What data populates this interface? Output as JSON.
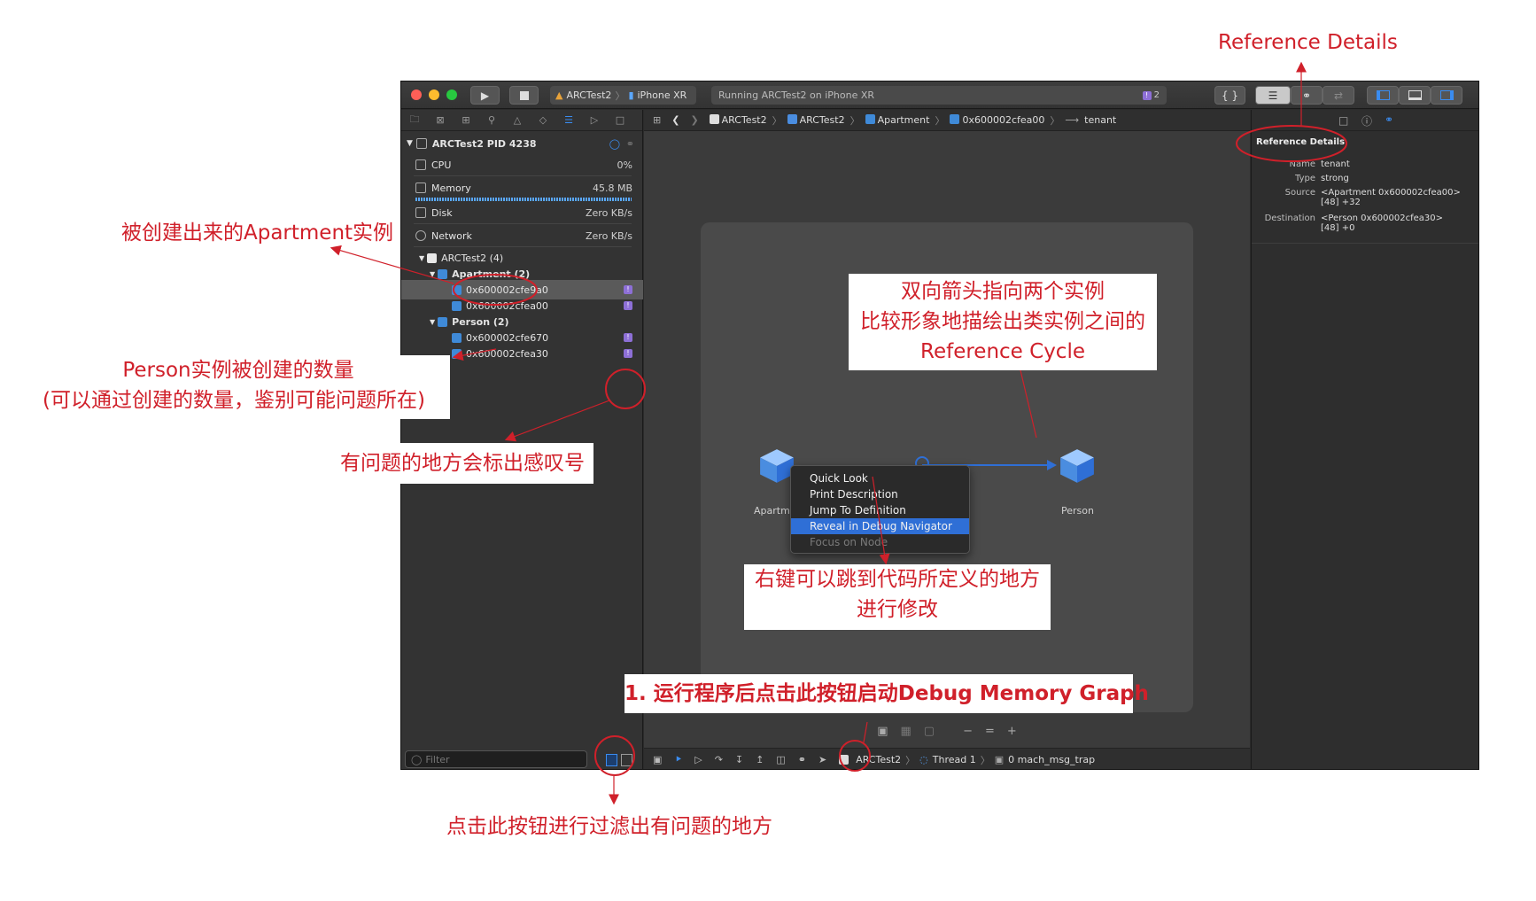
{
  "annotations": {
    "reference_details": "Reference Details",
    "apartment_instance": "被创建出来的Apartment实例",
    "person_count_line1": "Person实例被创建的数量",
    "person_count_line2": "(可以通过创建的数量，鉴别可能问题所在)",
    "exclamation_mark": "有问题的地方会标出感叹号",
    "arrow_line1": "双向箭头指向两个实例",
    "arrow_line2": "比较形象地描绘出类实例之间的",
    "arrow_line3": "Reference Cycle",
    "right_click_line1": "右键可以跳到代码所定义的地方",
    "right_click_line2": "进行修改",
    "start_graph": "1. 运行程序后点击此按钮启动Debug Memory Graph",
    "filter_button": "点击此按钮进行过滤出有问题的地方"
  },
  "toolbar": {
    "scheme_project": "ARCTest2",
    "scheme_device": "iPhone XR",
    "activity_text": "Running ARCTest2 on iPhone XR",
    "warning_count": "2",
    "warning_glyph": "!",
    "braces_label": "{ }"
  },
  "navigator": {
    "process": "ARCTest2 PID 4238",
    "gauges": [
      {
        "label": "CPU",
        "value": "0%"
      },
      {
        "label": "Memory",
        "value": "45.8 MB"
      },
      {
        "label": "Disk",
        "value": "Zero KB/s"
      },
      {
        "label": "Network",
        "value": "Zero KB/s"
      }
    ],
    "tree": {
      "module": "ARCTest2 (4)",
      "apartment_group": "Apartment (2)",
      "apartment_items": [
        "0x600002cfe9a0",
        "0x600002cfea00"
      ],
      "person_group": "Person (2)",
      "person_items": [
        "0x600002cfe670",
        "0x600002cfea30"
      ]
    },
    "filter_placeholder": "Filter"
  },
  "editor": {
    "breadcrumbs": [
      "ARCTest2",
      "ARCTest2",
      "Apartment",
      "0x600002cfea00",
      "tenant"
    ],
    "nodes": {
      "left": "Apartm",
      "right": "Person"
    },
    "context_menu": [
      {
        "label": "Quick Look",
        "state": "normal"
      },
      {
        "label": "Print Description",
        "state": "normal"
      },
      {
        "label": "Jump To Definition",
        "state": "normal"
      },
      {
        "label": "Reveal in Debug Navigator",
        "state": "highlighted"
      },
      {
        "label": "Focus on Node",
        "state": "disabled"
      }
    ],
    "debug_bar": {
      "target": "ARCTest2",
      "thread": "Thread 1",
      "frame": "0 mach_msg_trap"
    }
  },
  "inspector": {
    "title": "Reference Details",
    "name_key": "Name",
    "name_val": "tenant",
    "type_key": "Type",
    "type_val": "strong",
    "source_key": "Source",
    "source_val1": "<Apartment 0x600002cfea00>",
    "source_val2": "[48] +32",
    "dest_key": "Destination",
    "dest_val1": "<Person 0x600002cfea30>",
    "dest_val2": "[48] +0"
  },
  "colors": {
    "annotation": "#d0202a",
    "accent": "#3a8cf0",
    "warning": "#8d6fd6"
  }
}
